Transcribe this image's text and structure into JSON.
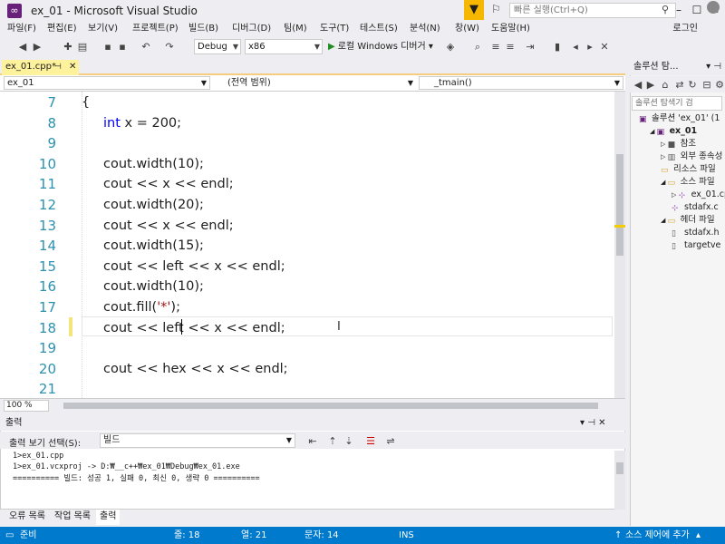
{
  "window": {
    "title": "ex_01 - Microsoft Visual Studio",
    "quick_launch_placeholder": "빠른 실행(Ctrl+Q)"
  },
  "menu": {
    "items": [
      "파일(F)",
      "편집(E)",
      "보기(V)",
      "프로젝트(P)",
      "빌드(B)",
      "디버그(D)",
      "팀(M)",
      "도구(T)",
      "테스트(S)",
      "분석(N)",
      "창(W)",
      "도움말(H)"
    ],
    "login": "로그인"
  },
  "toolbar": {
    "config": "Debug",
    "platform": "x86",
    "run_label": "로컬 Windows 디버거"
  },
  "editor": {
    "tab_label": "ex_01.cpp*",
    "tab_pin": "⊕",
    "nav_project": "ex_01",
    "nav_scope": "(전역 범위)",
    "nav_function": "_tmain()",
    "lines": [
      {
        "num": "7",
        "code": "{"
      },
      {
        "num": "8",
        "code": "int x = 200;"
      },
      {
        "num": "9",
        "code": ""
      },
      {
        "num": "10",
        "code": "cout.width(10);"
      },
      {
        "num": "11",
        "code": "cout << x << endl;"
      },
      {
        "num": "12",
        "code": "cout.width(20);"
      },
      {
        "num": "13",
        "code": "cout << x << endl;"
      },
      {
        "num": "14",
        "code": "cout.width(15);"
      },
      {
        "num": "15",
        "code": "cout << left << x << endl;"
      },
      {
        "num": "16",
        "code": "cout.width(10);"
      },
      {
        "num": "17",
        "code": "cout.fill('*');"
      },
      {
        "num": "18",
        "code": "cout << left << x << endl;"
      },
      {
        "num": "19",
        "code": ""
      },
      {
        "num": "20",
        "code": "cout << hex << x << endl;"
      },
      {
        "num": "21",
        "code": ""
      }
    ],
    "zoom": "100 %"
  },
  "output": {
    "title": "출력",
    "source_label": "출력 보기 선택(S):",
    "source_value": "빌드",
    "lines": [
      "1>ex_01.cpp",
      "1>ex_01.vcxproj -> D:₩__c++₩ex_01₩Debug₩ex_01.exe",
      "========== 빌드: 성공 1, 실패 0, 최신 0, 생략 0 =========="
    ]
  },
  "bottom_tabs": [
    "오류 목록",
    "작업 목록",
    "출력"
  ],
  "status": {
    "ready": "준비",
    "line": "줄: 18",
    "col": "열: 21",
    "char": "문자: 14",
    "ins": "INS",
    "source_control": "소스 제어에 추가"
  },
  "solution_explorer": {
    "title": "솔루션 탐...",
    "search_placeholder": "솔루션 탐색기 검",
    "tree": [
      {
        "label": "솔루션 'ex_01' (1",
        "indent": 0
      },
      {
        "label": "ex_01",
        "indent": 1
      },
      {
        "label": "참조",
        "indent": 2
      },
      {
        "label": "외부 종속성",
        "indent": 2
      },
      {
        "label": "리소스 파일",
        "indent": 2
      },
      {
        "label": "소스 파일",
        "indent": 2
      },
      {
        "label": "ex_01.cp",
        "indent": 3
      },
      {
        "label": "stdafx.c",
        "indent": 3
      },
      {
        "label": "헤더 파일",
        "indent": 2
      },
      {
        "label": "stdafx.h",
        "indent": 3
      },
      {
        "label": "targetve",
        "indent": 3
      }
    ]
  },
  "colors": {
    "status_bar": "#007acc",
    "keyword": "#0000ff",
    "line_number": "#2b91af",
    "tab_active": "#fff29d"
  }
}
